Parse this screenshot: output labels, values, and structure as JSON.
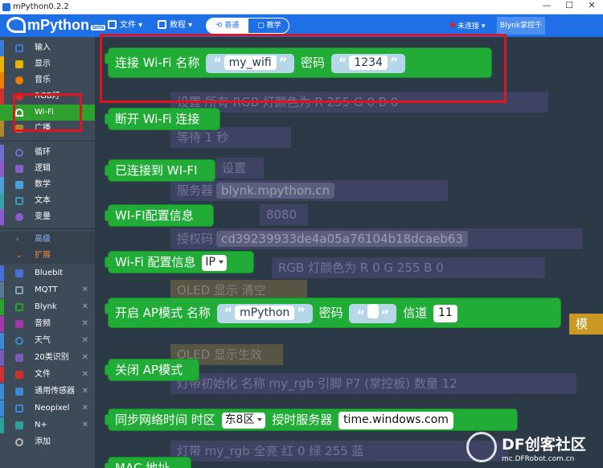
{
  "window": {
    "title": "mPython0.2.2",
    "minimize": "—",
    "maximize": "☐",
    "close": "✕"
  },
  "toolbar": {
    "logo": "mPython",
    "logo_badge": "beta",
    "file": "文件",
    "tutorial": "教程",
    "mode_normal": "普通",
    "mode_teach": "教学",
    "status": "未连接",
    "blynk_button": "Blynk掌控千目"
  },
  "sidebar": {
    "items": [
      {
        "label": "输入",
        "color": "#3b7bd8"
      },
      {
        "label": "显示",
        "color": "#e8b400"
      },
      {
        "label": "音乐",
        "color": "#f07c00"
      },
      {
        "label": "RGB灯",
        "color": "#d03030"
      },
      {
        "label": "Wi-Fi",
        "color": "#2ea02e"
      },
      {
        "label": "广播",
        "color": "#b08a2a"
      },
      {
        "label": "循环",
        "color": "#6e6ecc"
      },
      {
        "label": "逻辑",
        "color": "#8a5ccc"
      },
      {
        "label": "数学",
        "color": "#4aa0d8"
      },
      {
        "label": "文本",
        "color": "#3aa0a8"
      },
      {
        "label": "变量",
        "color": "#8a5ccc"
      }
    ],
    "advanced": "高级",
    "extensions": "扩展",
    "ext_items": [
      {
        "label": "Bluebit",
        "color": "#4a6ed8"
      },
      {
        "label": "MQTT",
        "color": "#5a7a90"
      },
      {
        "label": "Blynk",
        "color": "#2ea02e"
      },
      {
        "label": "音频",
        "color": "#a03aa8"
      },
      {
        "label": "天气",
        "color": "#3a8ad8"
      },
      {
        "label": "20类识别",
        "color": "#7a5ab8"
      },
      {
        "label": "文件",
        "color": "#d03030"
      },
      {
        "label": "通用传感器",
        "color": "#3a8ad8"
      },
      {
        "label": "Neopixel",
        "color": "#3a8ad8"
      },
      {
        "label": "N+",
        "color": "#2ea09a"
      },
      {
        "label": "添加",
        "color": "#888888"
      }
    ],
    "close_mark": "✕"
  },
  "blocks": {
    "connect": {
      "prefix": "连接 Wi-Fi 名称",
      "ssid": "my_wifi",
      "pwd_label": "密码",
      "pwd": "1234"
    },
    "disconnect": "断开 Wi-Fi 连接",
    "connected": "已连接到 WI-FI",
    "config": "WI-FI配置信息",
    "config2": {
      "label": "Wi-Fi 配置信息",
      "option": "IP"
    },
    "ap": {
      "prefix": "开启 AP模式 名称",
      "name": "mPython",
      "pwd_label": "密码",
      "channel_label": "信道",
      "channel": "11"
    },
    "close_ap": "关闭 AP模式",
    "ntp": {
      "prefix": "同步网络时间 时区",
      "zone": "东8区",
      "server_label": "授时服务器",
      "server": "time.windows.com"
    },
    "mac": "MAC 地址"
  },
  "ghosts": {
    "g1": "设置  所有  RGB 灯颜色为 R  255  G  0  B  0",
    "g2": "等待  1  秒",
    "g3": "设置",
    "g4": "服务器",
    "g4v": "blynk.mpython.cn",
    "g5": "8080",
    "g6": "授权码",
    "g6v": "cd39239933de4a05a76104b18dcaeb63",
    "g7": "RGB 灯颜色为 R  0  G  255  B  0",
    "g8": "OLED 显示  清空",
    "g9": "OLED 显示生效",
    "g10": "灯带初始化 名称  my_rgb  引脚  P7 (掌控板)  数量  12",
    "g11": "灯带  my_rgb  全亮 红  0  绿  255  蓝",
    "g12": "模"
  },
  "watermark": {
    "title": "DF创客社区",
    "url": "mc.DFRobot.com.cn"
  }
}
